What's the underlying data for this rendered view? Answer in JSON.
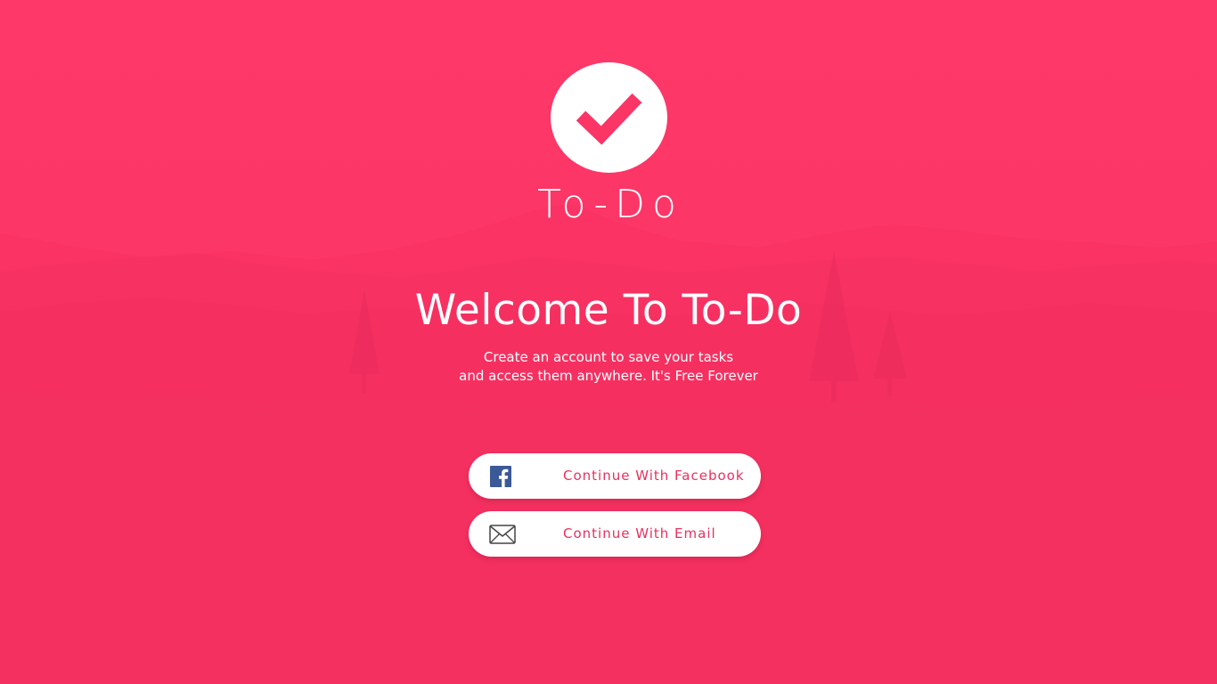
{
  "app": {
    "name": "To-Do",
    "logo_icon": "checkmark-icon"
  },
  "welcome": {
    "heading": "Welcome To To-Do",
    "subtitle_line1": "Create an account to save your tasks",
    "subtitle_line2": "and access them anywhere. It's Free Forever"
  },
  "auth": {
    "facebook": {
      "label": "Continue With Facebook",
      "icon": "facebook-icon"
    },
    "email": {
      "label": "Continue With Email",
      "icon": "envelope-icon"
    }
  },
  "colors": {
    "background": "#fb3566",
    "accent": "#e8305d",
    "facebook_blue": "#3b5998",
    "text_light": "#ffffff"
  }
}
